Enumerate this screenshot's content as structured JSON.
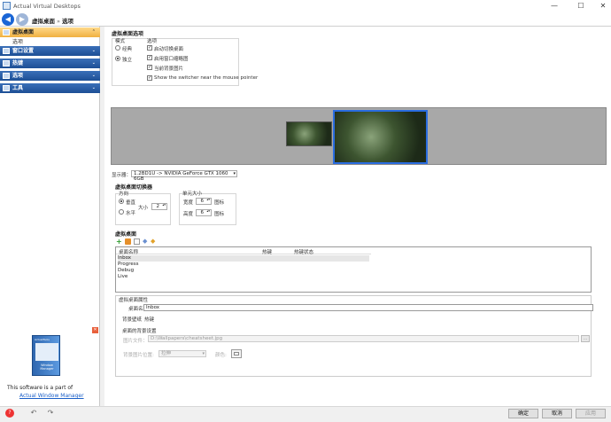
{
  "window": {
    "title": "Actual Virtual Desktops",
    "min": "—",
    "max": "☐",
    "close": "✕"
  },
  "nav": {
    "crumb_root": "虚拟桌面",
    "crumb_sep": "»",
    "crumb_current": "选项"
  },
  "sidebar": {
    "sections": [
      {
        "label": "虚拟桌面",
        "chevron": "⌃"
      },
      {
        "label": "窗口设置",
        "chevron": "⌄"
      },
      {
        "label": "热键",
        "chevron": "⌄"
      },
      {
        "label": "选项",
        "chevron": "⌄"
      },
      {
        "label": "工具",
        "chevron": "⌄"
      }
    ],
    "subitem": "选项"
  },
  "ad": {
    "close": "✕",
    "box_title": "Window Manager",
    "box_brand": "ActualTools",
    "line1": "This software is a part of",
    "link": "Actual Window Manager"
  },
  "options": {
    "title": "虚拟桌面选项",
    "mode_label": "模式",
    "mode_classic": "经典",
    "mode_independent": "独立",
    "opts_label": "选项",
    "opt1": "启动切换桌面",
    "opt2": "启用窗口缩略图",
    "opt3": "当前背景图片",
    "opt4": "Show the switcher near the mouse pointer"
  },
  "monitor": {
    "label": "显示器：",
    "value": "1.2BD1U -> NVIDIA GeForce GTX 1060 6GB"
  },
  "switcher": {
    "title": "虚拟桌面切换器",
    "dir_label": "方向",
    "vertical": "垂直",
    "horizontal": "水平",
    "size_label": "大小",
    "size_value": "2",
    "cell_label": "单元大小",
    "width_label": "宽度",
    "width_value": "6",
    "height_label": "高度",
    "height_value": "6",
    "unit": "图标"
  },
  "desktops": {
    "title": "虚拟桌面",
    "columns": [
      "桌面名称",
      "热键",
      "热键状态"
    ],
    "rows": [
      "Inbox",
      "Progress",
      "Debug",
      "Live"
    ]
  },
  "props": {
    "title": "虚拟桌面属性",
    "name_label": "桌面名称:",
    "name_value": "Inbox",
    "tab1": "背景壁纸",
    "tab2": "热键",
    "bg_label": "桌面的背景设置",
    "file_label": "图片文件：",
    "file_value": "D:\\Wallpapers\\cheatsheet.jpg",
    "browse": "...",
    "pos_label": "背景图片位置:",
    "pos_value": "拉伸",
    "color_label": "颜色:"
  },
  "buttons": {
    "ok": "确定",
    "cancel": "取消",
    "apply": "应用"
  },
  "colors": {
    "accent": "#1d4f95",
    "active": "#f0b040"
  }
}
